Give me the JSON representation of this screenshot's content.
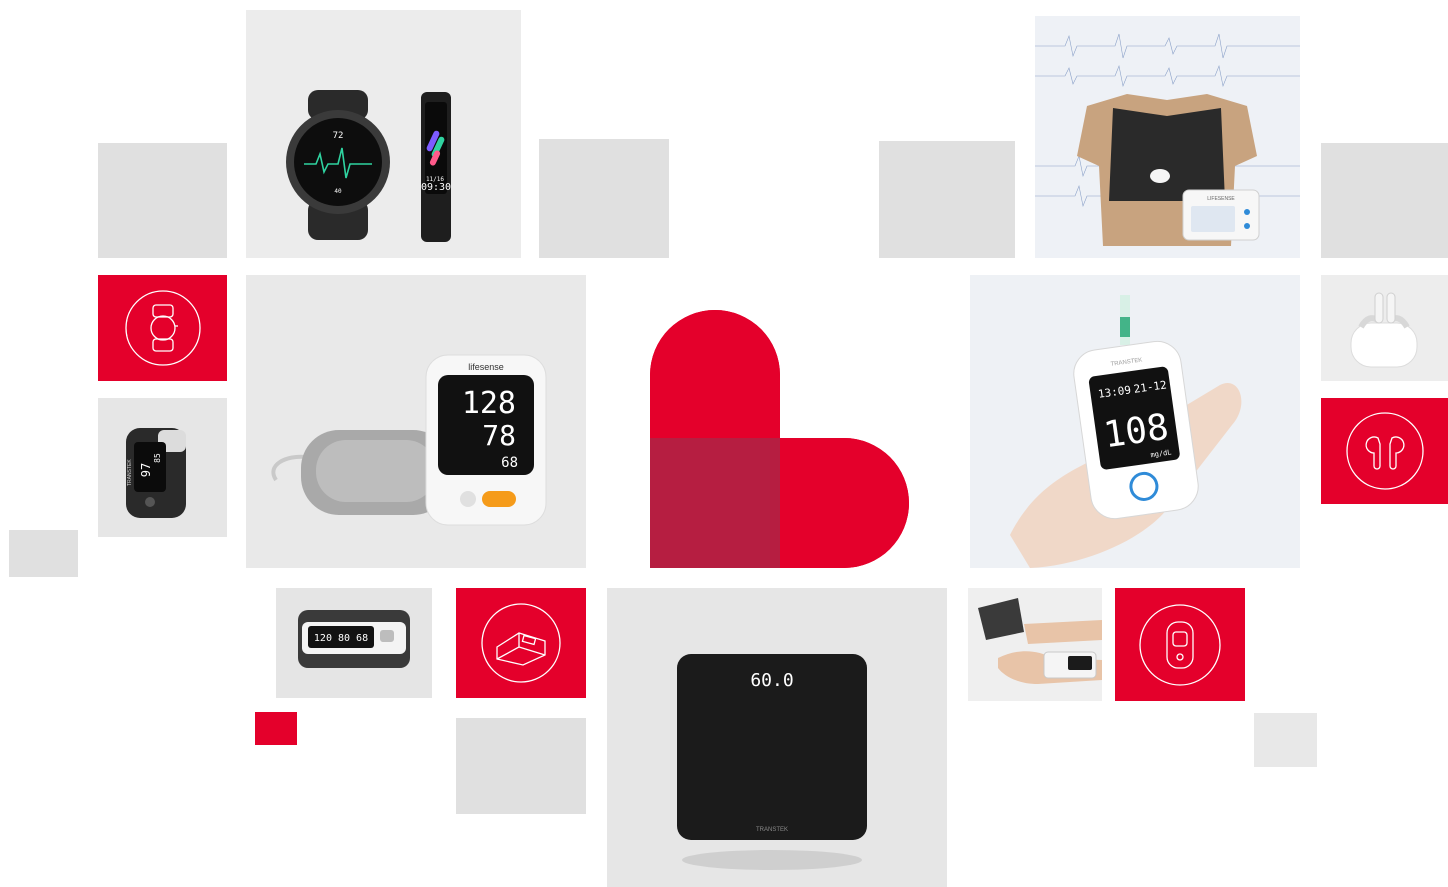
{
  "colors": {
    "brand_red": "#e4002b",
    "brand_dark_red": "#b31b3f",
    "tile_grey": "#e0e0e0",
    "device_black": "#1b1b1b",
    "watch_accent": "#2fd3a0"
  },
  "icons": {
    "watch_tile": "smartwatch-icon",
    "bp_tile": "blood-pressure-cuff-icon",
    "oximeter_tile": "fingertip-oximeter-icon",
    "earbuds_tile": "earbuds-icon",
    "logo": "heart-l-logo"
  },
  "watch": {
    "heart_rate": "72",
    "time": "09:30",
    "date": "11/16",
    "step": "40"
  },
  "bp_monitor": {
    "brand": "lifesense",
    "systolic": "128",
    "diastolic": "78",
    "pulse": "68"
  },
  "glucose_meter": {
    "brand": "TRANSTEK",
    "clock": "13:09",
    "date": "21-12",
    "reading": "108",
    "unit": "mg/dL"
  },
  "oximeter": {
    "brand": "TRANSTEK",
    "spo2": "97",
    "pulse": "85"
  },
  "arm_bp": {
    "display": "120 80 68"
  },
  "scale": {
    "weight": "60.0",
    "brand": "TRANSTEK"
  },
  "ecg": {
    "brand": "LIFESENSE"
  }
}
